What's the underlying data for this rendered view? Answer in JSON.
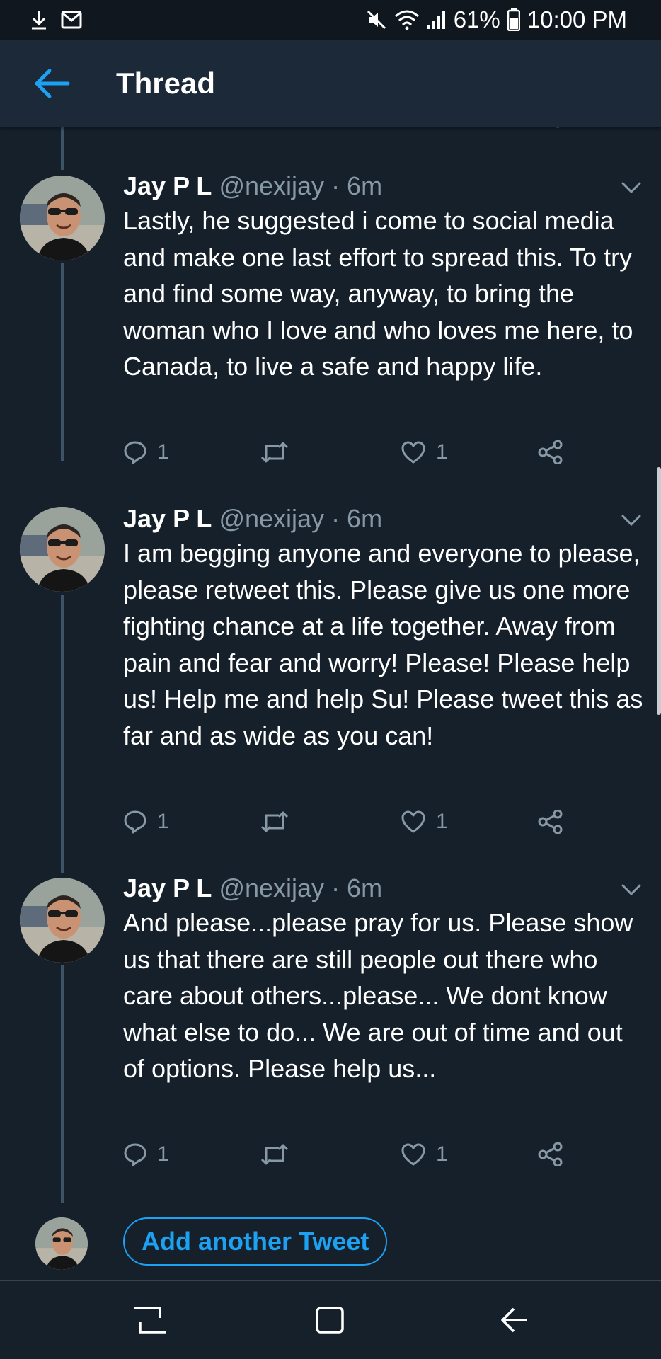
{
  "status_bar": {
    "battery_percent": "61%",
    "time": "10:00 PM"
  },
  "header": {
    "title": "Thread"
  },
  "tweets": [
    {
      "name": "Jay P L",
      "handle": "@nexijay",
      "time": "· 6m",
      "text": "Lastly, he suggested i come to social media and make one last effort to spread this. To try and find some way, anyway, to bring the woman who I love and who loves me here, to Canada, to live a safe and happy life.",
      "reply_count": "1",
      "like_count": "1"
    },
    {
      "name": "Jay P L",
      "handle": "@nexijay",
      "time": "· 6m",
      "text": "I am begging anyone and everyone to please, please retweet this. Please give us one more fighting chance at a life together. Away from pain and fear and worry! Please! Please help us! Help me and help Su! Please tweet this as far and as wide as you can!",
      "reply_count": "1",
      "like_count": "1"
    },
    {
      "name": "Jay P L",
      "handle": "@nexijay",
      "time": "· 6m",
      "text": "And please...please pray for us. Please show us that there are still people out there who care about others...please... We dont know what else to do... We are out of time and out of options. Please help us...",
      "reply_count": "1",
      "like_count": "1"
    }
  ],
  "compose": {
    "add_button_label": "Add another Tweet"
  },
  "colors": {
    "background": "#15202b",
    "header": "#1c2938",
    "accent": "#1da1f2",
    "secondary_text": "#8899a6",
    "thread_line": "#3d5466"
  },
  "icons": {
    "status_left": [
      "download-icon",
      "gmail-icon"
    ],
    "status_right": [
      "mute-icon",
      "wifi-icon",
      "signal-icon",
      "battery-icon"
    ],
    "tweet_actions": [
      "reply-icon",
      "retweet-icon",
      "like-icon",
      "share-icon"
    ],
    "nav": [
      "recents-icon",
      "home-icon",
      "back-nav-icon"
    ]
  }
}
